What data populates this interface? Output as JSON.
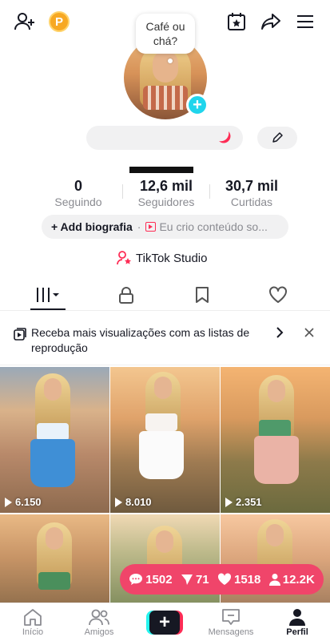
{
  "colors": {
    "accent": "#fe2c55",
    "cyan": "#20d5ec",
    "coin": "#f7a823",
    "overlay": "#f0456a"
  },
  "header": {
    "icons": [
      "add-user-icon",
      "coin-icon",
      "calendar-star-icon",
      "share-icon",
      "menu-icon"
    ],
    "coin_letter": "P"
  },
  "profile": {
    "note_bubble": "Café ou chá?"
  },
  "stats": [
    {
      "value": "0",
      "label": "Seguindo"
    },
    {
      "value": "12,6 mil",
      "label": "Seguidores"
    },
    {
      "value": "30,7 mil",
      "label": "Curtidas"
    }
  ],
  "bio": {
    "add_label": "+ Add biografia",
    "separator": "·",
    "content": "Eu crio conteúdo so..."
  },
  "studio_label": "TikTok Studio",
  "tabs": [
    "videos-grid-icon",
    "lock-icon",
    "bookmark-icon",
    "heart-icon"
  ],
  "banner": {
    "text": "Receba mais visualizações com as listas de reprodução"
  },
  "videos": [
    {
      "views": "6.150"
    },
    {
      "views": "8.010"
    },
    {
      "views": "2.351"
    },
    {
      "views": ""
    },
    {
      "views": ""
    },
    {
      "views": ""
    }
  ],
  "overlay_stats": {
    "comments": "1502",
    "shares": "71",
    "likes": "1518",
    "followers": "12.2K"
  },
  "bottom_nav": {
    "home": "Início",
    "friends": "Amigos",
    "messages": "Mensagens",
    "profile": "Perfil"
  }
}
